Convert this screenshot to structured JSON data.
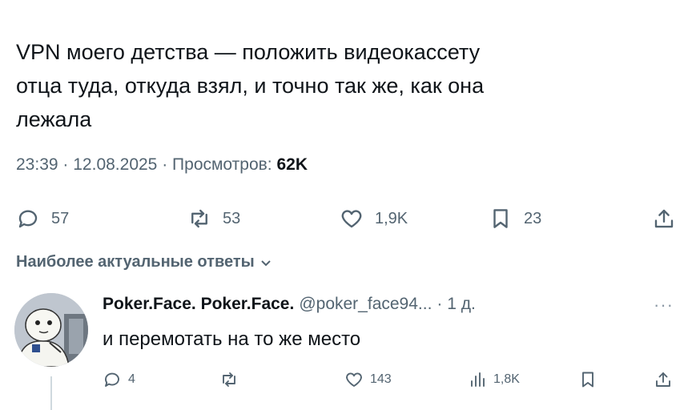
{
  "tweet": {
    "lines": [
      "VPN моего детства — положить видеокассету",
      "отца туда, откуда взял, и точно так же, как она",
      "лежала"
    ],
    "time": "23:39",
    "date": "12.08.2025",
    "views_label": "Просмотров:",
    "views_count": "62K",
    "separator": "·"
  },
  "actions": {
    "replies": "57",
    "reposts": "53",
    "likes": "1,9K",
    "bookmarks": "23"
  },
  "replies_section": {
    "label": "Наиболее актуальные ответы"
  },
  "reply": {
    "name": "Poker.Face. Poker.Face.",
    "handle": "@poker_face94...",
    "time": "· 1 д.",
    "more": "···",
    "text": "и перемотать на то же место",
    "replies": "4",
    "likes": "143",
    "views": "1,8K"
  },
  "icons": [
    "reply-icon",
    "repost-icon",
    "like-icon",
    "bookmark-icon",
    "share-icon",
    "chevron-down-icon",
    "views-icon"
  ]
}
